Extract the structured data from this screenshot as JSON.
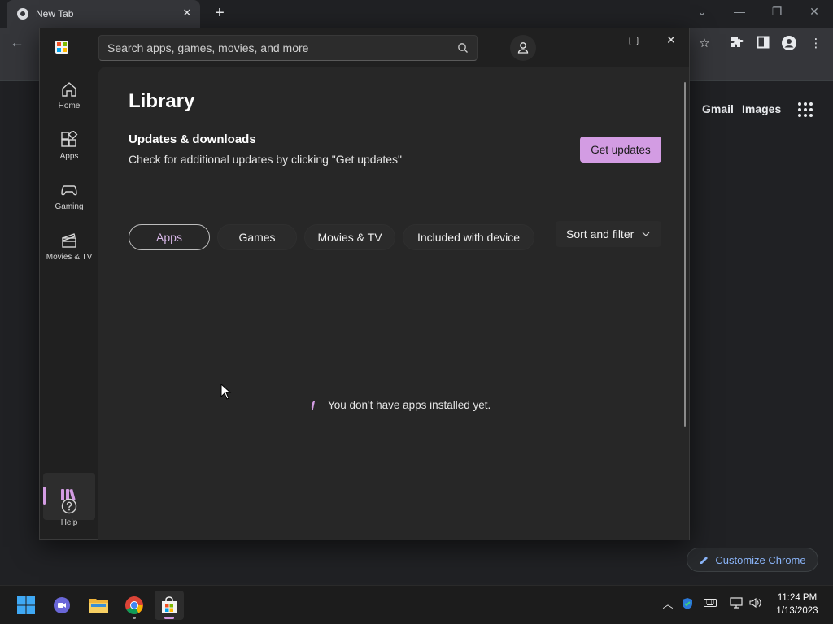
{
  "chrome": {
    "tab_title": "New Tab",
    "tab_close": "✕",
    "new_tab": "+",
    "links": {
      "gmail": "Gmail",
      "images": "Images"
    },
    "customize_label": "Customize Chrome"
  },
  "store": {
    "search_placeholder": "Search apps, games, movies, and more",
    "window_controls": {
      "minimize": "—",
      "maximize": "▢",
      "close": "✕"
    },
    "nav": [
      {
        "id": "home",
        "label": "Home",
        "icon": "home-icon"
      },
      {
        "id": "apps",
        "label": "Apps",
        "icon": "apps-icon"
      },
      {
        "id": "gaming",
        "label": "Gaming",
        "icon": "gaming-icon"
      },
      {
        "id": "movies",
        "label": "Movies & TV",
        "icon": "movies-icon"
      },
      {
        "id": "help",
        "label": "Help",
        "icon": "help-icon"
      }
    ],
    "library": {
      "title": "Library",
      "section_title": "Updates & downloads",
      "section_desc": "Check for additional updates by clicking \"Get updates\"",
      "get_updates": "Get updates",
      "filters": [
        "Apps",
        "Games",
        "Movies & TV",
        "Included with device"
      ],
      "active_filter": "Apps",
      "sort_filter": "Sort and filter",
      "empty_message": "You don't have apps installed yet."
    },
    "accent_color": "#d39ce3"
  },
  "taskbar": {
    "apps": [
      "windows-start",
      "teams-chat",
      "file-explorer",
      "chrome",
      "microsoft-store"
    ],
    "active_app": "microsoft-store",
    "time": "11:24 PM",
    "date": "1/13/2023"
  }
}
